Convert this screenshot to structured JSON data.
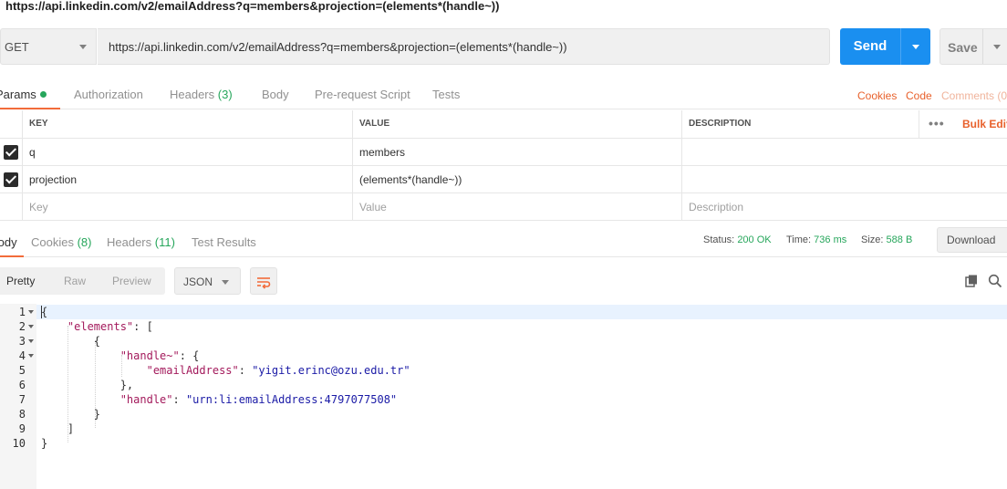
{
  "page_title_url": "https://api.linkedin.com/v2/emailAddress?q=members&projection=(elements*(handle~))",
  "request": {
    "method": "GET",
    "url": "https://api.linkedin.com/v2/emailAddress?q=members&projection=(elements*(handle~))",
    "send_label": "Send",
    "save_label": "Save"
  },
  "request_tabs": {
    "params": "Params",
    "authorization": "Authorization",
    "headers": "Headers",
    "headers_count": "(3)",
    "body": "Body",
    "prerequest": "Pre-request Script",
    "tests": "Tests",
    "cookies_link": "Cookies",
    "code_link": "Code",
    "comments_link": "Comments (0"
  },
  "params_table": {
    "headers": {
      "key": "KEY",
      "value": "VALUE",
      "description": "DESCRIPTION",
      "bulk_edit": "Bulk Edit"
    },
    "rows": [
      {
        "checked": true,
        "key": "q",
        "value": "members",
        "description": ""
      },
      {
        "checked": true,
        "key": "projection",
        "value": "(elements*(handle~))",
        "description": ""
      }
    ],
    "placeholder": {
      "key": "Key",
      "value": "Value",
      "description": "Description"
    }
  },
  "response_tabs": {
    "body": "Body",
    "cookies": "Cookies",
    "cookies_count": "(8)",
    "headers": "Headers",
    "headers_count": "(11)",
    "test_results": "Test Results"
  },
  "response_meta": {
    "status_label": "Status:",
    "status_value": "200 OK",
    "time_label": "Time:",
    "time_value": "736 ms",
    "size_label": "Size:",
    "size_value": "588 B",
    "download": "Download"
  },
  "body_toolbar": {
    "pretty": "Pretty",
    "raw": "Raw",
    "preview": "Preview",
    "format": "JSON"
  },
  "code": {
    "line_numbers": [
      "1",
      "2",
      "3",
      "4",
      "5",
      "6",
      "7",
      "8",
      "9",
      "10"
    ],
    "key_elements": "\"elements\"",
    "key_handle_tilde": "\"handle~\"",
    "key_email": "\"emailAddress\"",
    "val_email": "\"yigit.erinc@ozu.edu.tr\"",
    "key_handle": "\"handle\"",
    "val_handle": "\"urn:li:emailAddress:4797077508\""
  },
  "colors": {
    "send_blue": "#1a8ff0",
    "accent_orange": "#f26b3a",
    "status_green": "#26a65b",
    "json_key": "#a3195b",
    "json_string": "#1a1aa6"
  }
}
